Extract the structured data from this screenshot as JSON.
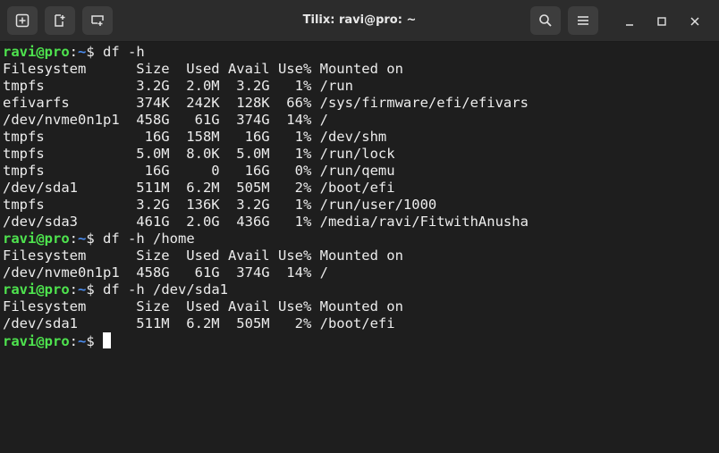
{
  "window": {
    "title": "Tilix: ravi@pro: ~"
  },
  "toolbar": {
    "buttons": [
      {
        "name": "new-session-button",
        "icon": "add-session-icon"
      },
      {
        "name": "split-vertical-button",
        "icon": "split-add-icon"
      },
      {
        "name": "split-horizontal-button",
        "icon": "split-down-icon"
      }
    ]
  },
  "prompt": {
    "user_host": "ravi@pro",
    "separator": ":",
    "path": "~",
    "symbol": "$ "
  },
  "terminal": {
    "lines": [
      {
        "type": "prompt",
        "command": "df -h"
      },
      {
        "type": "output",
        "text": "Filesystem      Size  Used Avail Use% Mounted on"
      },
      {
        "type": "output",
        "text": "tmpfs           3.2G  2.0M  3.2G   1% /run"
      },
      {
        "type": "output",
        "text": "efivarfs        374K  242K  128K  66% /sys/firmware/efi/efivars"
      },
      {
        "type": "output",
        "text": "/dev/nvme0n1p1  458G   61G  374G  14% /"
      },
      {
        "type": "output",
        "text": "tmpfs            16G  158M   16G   1% /dev/shm"
      },
      {
        "type": "output",
        "text": "tmpfs           5.0M  8.0K  5.0M   1% /run/lock"
      },
      {
        "type": "output",
        "text": "tmpfs            16G     0   16G   0% /run/qemu"
      },
      {
        "type": "output",
        "text": "/dev/sda1       511M  6.2M  505M   2% /boot/efi"
      },
      {
        "type": "output",
        "text": "tmpfs           3.2G  136K  3.2G   1% /run/user/1000"
      },
      {
        "type": "output",
        "text": "/dev/sda3       461G  2.0G  436G   1% /media/ravi/FitwithAnusha"
      },
      {
        "type": "prompt",
        "command": "df -h /home"
      },
      {
        "type": "output",
        "text": "Filesystem      Size  Used Avail Use% Mounted on"
      },
      {
        "type": "output",
        "text": "/dev/nvme0n1p1  458G   61G  374G  14% /"
      },
      {
        "type": "prompt",
        "command": "df -h /dev/sda1"
      },
      {
        "type": "output",
        "text": "Filesystem      Size  Used Avail Use% Mounted on"
      },
      {
        "type": "output",
        "text": "/dev/sda1       511M  6.2M  505M   2% /boot/efi"
      },
      {
        "type": "prompt",
        "command": "",
        "cursor": true
      }
    ]
  },
  "colors": {
    "background": "#1e1e1e",
    "titlebar": "#2c2c2c",
    "prompt_user": "#4ee34e",
    "prompt_path": "#4b8df0",
    "text": "#ececec"
  }
}
